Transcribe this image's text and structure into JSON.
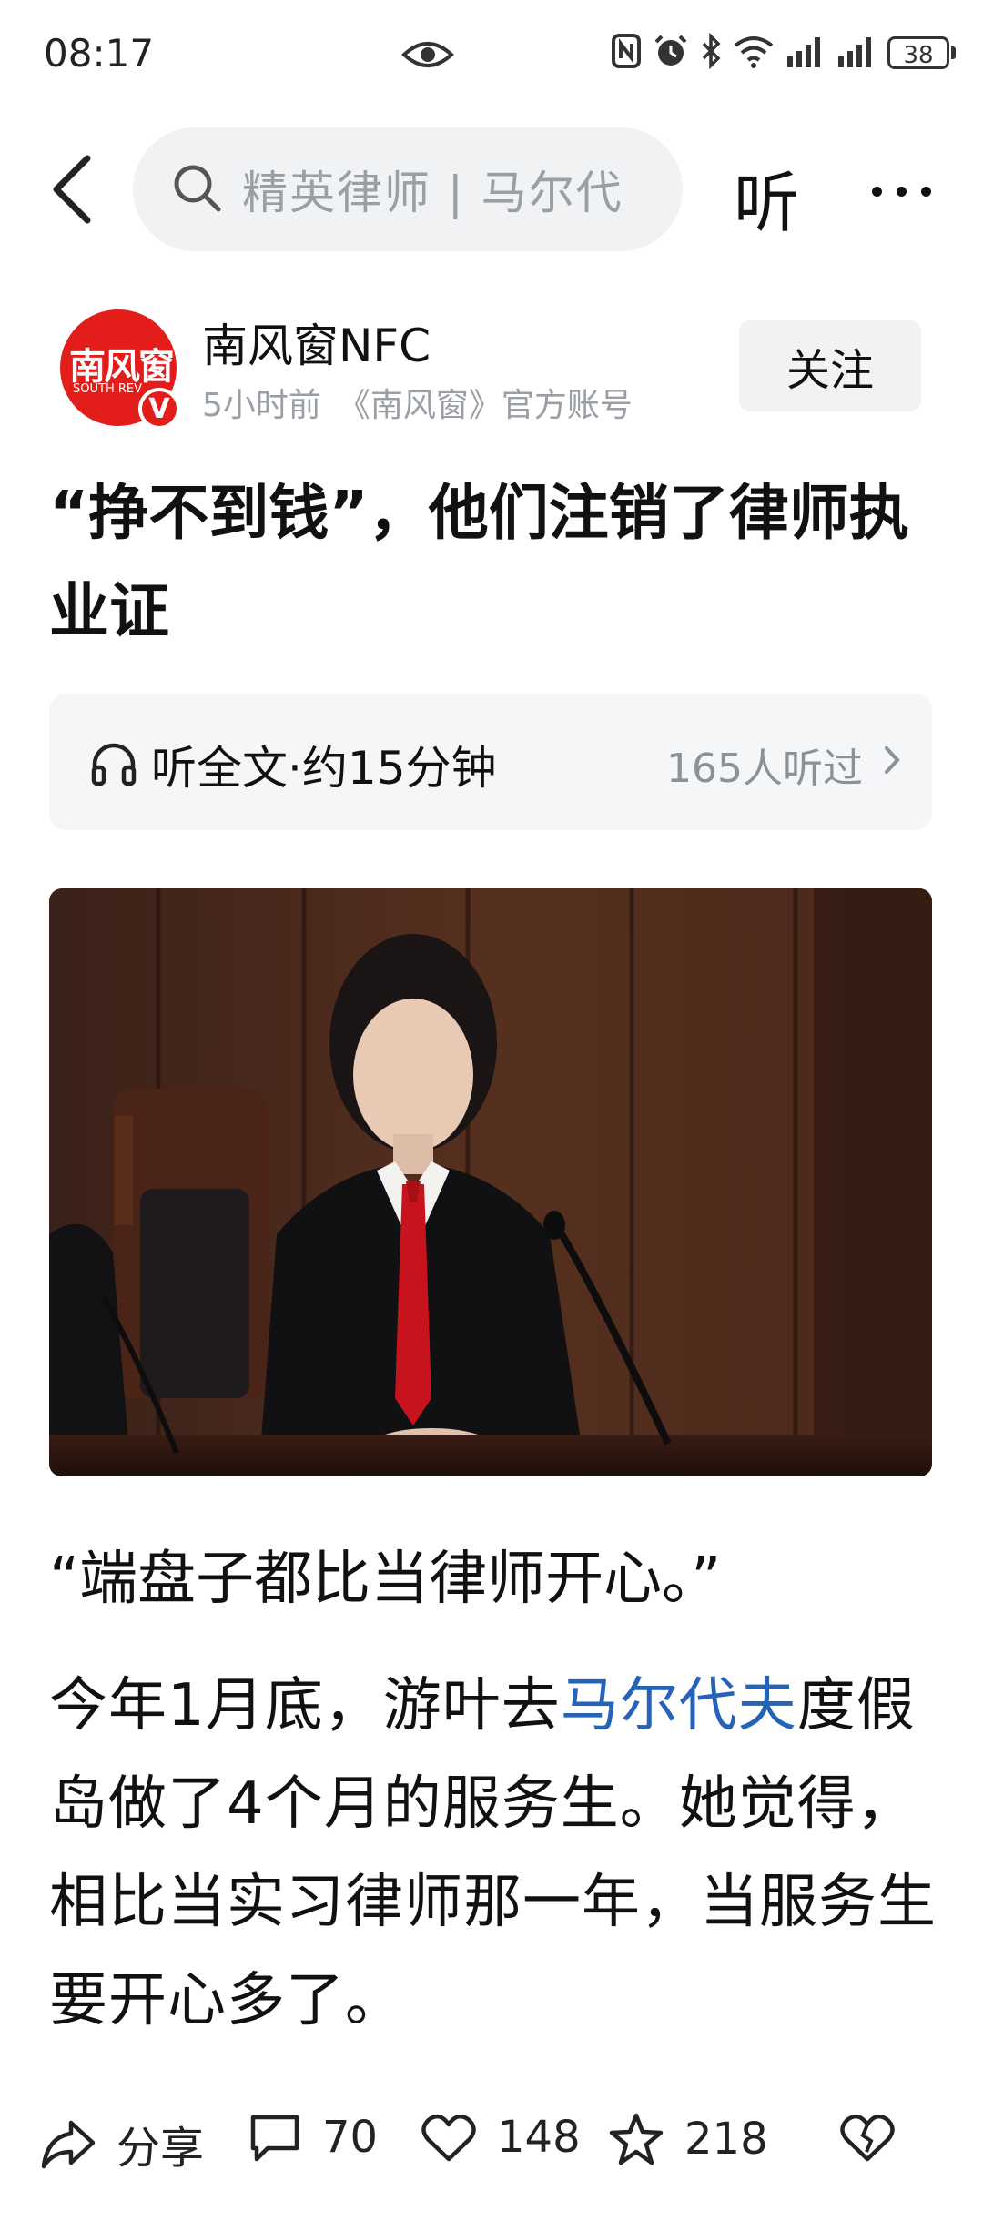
{
  "status_bar": {
    "time": "08:17",
    "battery": "38",
    "icons": [
      "eye-icon",
      "nfc-icon",
      "alarm-icon",
      "bluetooth-icon",
      "wifi-icon",
      "signal-icon",
      "signal-icon",
      "battery-icon"
    ]
  },
  "nav": {
    "search_placeholder": "精英律师 | 马尔代",
    "listen_label": "听"
  },
  "author": {
    "avatar_text": "南风窗",
    "avatar_sub": "SOUTH REV",
    "verified_mark": "V",
    "name": "南风窗NFC",
    "meta": "5小时前　《南风窗》官方账号",
    "follow_label": "关注"
  },
  "article": {
    "title": "“挣不到钱”，他们注销了律师执业证",
    "listen_bar": {
      "label": "听全文·约15分钟",
      "count": "165人听过"
    },
    "quote": "“端盘子都比当律师开心。”",
    "para_before_link": "今年1月底，游叶去",
    "para_link": "马尔代夫",
    "para_after_link": "度假岛做了4个月的服务生。她觉得，相比当实习律师那一年，当服务生要开心多了。"
  },
  "bottom_bar": {
    "share_label": "分享",
    "comment_count": "70",
    "like_count": "148",
    "favorite_count": "218"
  },
  "colors": {
    "brand_red": "#e31d1a",
    "link_blue": "#2463b8",
    "muted_gray": "#9a9ea5",
    "panel_gray": "#f1f2f4"
  }
}
